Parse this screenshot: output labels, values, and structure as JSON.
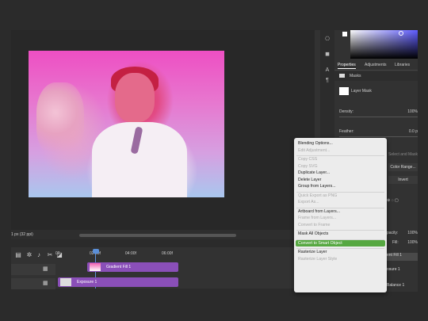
{
  "canvas": {
    "status": "1 px (32 ppi)"
  },
  "timeline": {
    "ruler": [
      "00",
      "02:00f",
      "04:00f",
      "06:00f"
    ],
    "tracks": [
      {
        "name": "Gradient Fill 1"
      },
      {
        "name": "Exposure 1"
      }
    ]
  },
  "properties": {
    "tabs": [
      "Properties",
      "Adjustments",
      "Libraries"
    ],
    "section": "Masks",
    "layer_mask": "Layer Mask",
    "density_label": "Density:",
    "density_value": "100%",
    "feather_label": "Feather:",
    "feather_value": "0.0 p",
    "select_and_mask": "Select and Mask",
    "color_range": "Color Range...",
    "invert": "Invert"
  },
  "layers_panel": {
    "opacity_label": "pacity:",
    "opacity_value": "100%",
    "fill_label": "Fill:",
    "fill_value": "100%",
    "rows": [
      "ent Fill 1",
      "osure 1",
      "Balance 1"
    ]
  },
  "context_menu": {
    "items": [
      {
        "label": "Blending Options...",
        "enabled": true
      },
      {
        "label": "Edit Adjustment...",
        "enabled": false
      },
      {
        "sep": true
      },
      {
        "label": "Copy CSS",
        "enabled": false
      },
      {
        "label": "Copy SVG",
        "enabled": false
      },
      {
        "label": "Duplicate Layer...",
        "enabled": true
      },
      {
        "label": "Delete Layer",
        "enabled": true
      },
      {
        "label": "Group from Layers...",
        "enabled": true
      },
      {
        "sep": true
      },
      {
        "label": "Quick Export as PNG",
        "enabled": false
      },
      {
        "label": "Export As...",
        "enabled": false
      },
      {
        "sep": true
      },
      {
        "label": "Artboard from Layers...",
        "enabled": true
      },
      {
        "label": "Frame from Layers...",
        "enabled": false
      },
      {
        "label": "Convert to Frame",
        "enabled": false
      },
      {
        "sep": true
      },
      {
        "label": "Mask All Objects",
        "enabled": true
      },
      {
        "sep": true
      },
      {
        "label": "Convert to Smart Object",
        "enabled": true,
        "highlighted": true
      },
      {
        "sep": true
      },
      {
        "label": "Rasterize Layer",
        "enabled": true
      },
      {
        "label": "Rasterize Layer Style",
        "enabled": false
      }
    ]
  },
  "colors": {
    "highlight": "#56a841",
    "clip": "#8a4fb8",
    "playhead": "#5b8fd8"
  }
}
